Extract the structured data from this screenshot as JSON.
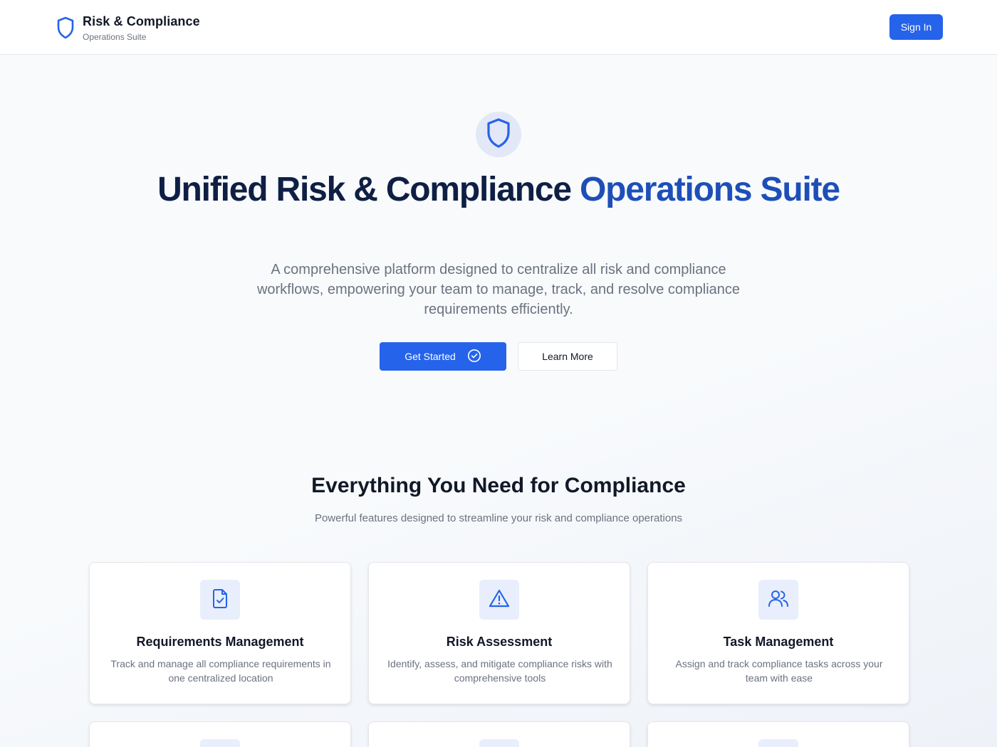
{
  "header": {
    "brand_title": "Risk & Compliance",
    "brand_subtitle": "Operations Suite",
    "brand_icon": "shield-icon",
    "signin_label": "Sign In"
  },
  "hero": {
    "badge_icon": "shield-icon",
    "title_part1": "Unified Risk & Compliance ",
    "title_part2": "Operations Suite",
    "description": "A comprehensive platform designed to centralize all risk and compliance workflows, empowering your team to manage, track, and resolve compliance requirements efficiently.",
    "primary_button": "Get Started",
    "primary_button_icon": "check-circle-icon",
    "secondary_button": "Learn More"
  },
  "features": {
    "title": "Everything You Need for Compliance",
    "subtitle": "Powerful features designed to streamline your risk and compliance operations",
    "cards": [
      {
        "icon": "document-check-icon",
        "title": "Requirements Management",
        "description": "Track and manage all compliance requirements in one centralized location"
      },
      {
        "icon": "warning-triangle-icon",
        "title": "Risk Assessment",
        "description": "Identify, assess, and mitigate compliance risks with comprehensive tools"
      },
      {
        "icon": "users-icon",
        "title": "Task Management",
        "description": "Assign and track compliance tasks across your team with ease"
      }
    ]
  },
  "colors": {
    "accent": "#2563eb",
    "title_dark": "#0f1f44",
    "title_accent": "#1e4fb8",
    "muted_text": "#6b7280",
    "icon_bg": "#e8eefb"
  }
}
